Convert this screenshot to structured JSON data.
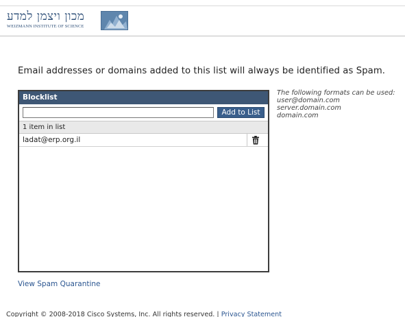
{
  "header": {
    "logo_hebrew": "מכון ויצמן למדע",
    "logo_english": "WEIZMANN INSTITUTE OF SCIENCE"
  },
  "intro_text": "Email addresses or domains added to this list will always be identified as Spam.",
  "blocklist": {
    "title": "Blocklist",
    "input_value": "",
    "add_button_label": "Add to List",
    "count_label": "1 item in list",
    "items": [
      {
        "address": "ladat@erp.org.il",
        "delete_icon": "trash-icon"
      }
    ]
  },
  "formats": {
    "hint": "The following formats can be used:",
    "examples": [
      "user@domain.com",
      "server.domain.com",
      "domain.com"
    ]
  },
  "quarantine_link": "View Spam Quarantine",
  "footer": {
    "copyright": "Copyright © 2008-2018 Cisco Systems, Inc. All rights reserved.",
    "separator": "|",
    "privacy_link": "Privacy Statement"
  },
  "colors": {
    "panel_header": "#3e5775",
    "button": "#3a5f8c",
    "link": "#2a5590",
    "logo": "#2e4f78"
  }
}
